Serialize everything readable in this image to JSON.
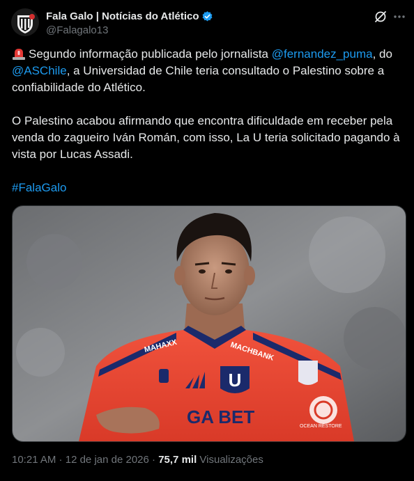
{
  "header": {
    "display_name": "Fala Galo | Notícias do Atlético",
    "handle": "@Falagalo13",
    "verified_color": "#1d9bf0"
  },
  "icons": {
    "avatar": "club-crest-avatar",
    "verified": "verified-badge-icon",
    "grok": "grok-icon",
    "more": "more-icon",
    "siren": "siren-emoji-icon"
  },
  "tweet": {
    "p1_a": "Segundo informação publicada pelo jornalista ",
    "mention1": "@fernandez_puma",
    "p1_b": ", do",
    "mention2": "@ASChile",
    "p1_c": ", a Universidad de Chile teria consultado o Palestino sobre a confiabilidade do Atlético.",
    "p2": "O Palestino acabou afirmando que encontra dificuldade em receber pela venda do zagueiro Iván Román, com isso,  La U teria solicitado pagando à vista por Lucas Assadi.",
    "hashtag": "#FalaGalo"
  },
  "media": {
    "jersey_text_left": "MAHAXX",
    "jersey_text_right": "MACHBANK",
    "jersey_sponsor": "GA BET",
    "jersey_crest": "U",
    "patch_text": "OCEAN RESTORE"
  },
  "meta": {
    "time": "10:21 AM",
    "separator": " · ",
    "date": "12 de jan de 2026",
    "views_count": "75,7 mil",
    "views_label": " Visualizações"
  },
  "colors": {
    "background": "#000000",
    "text": "#e7e9ea",
    "secondary": "#71767b",
    "link": "#1d9bf0",
    "jersey_red": "#e8432f"
  }
}
